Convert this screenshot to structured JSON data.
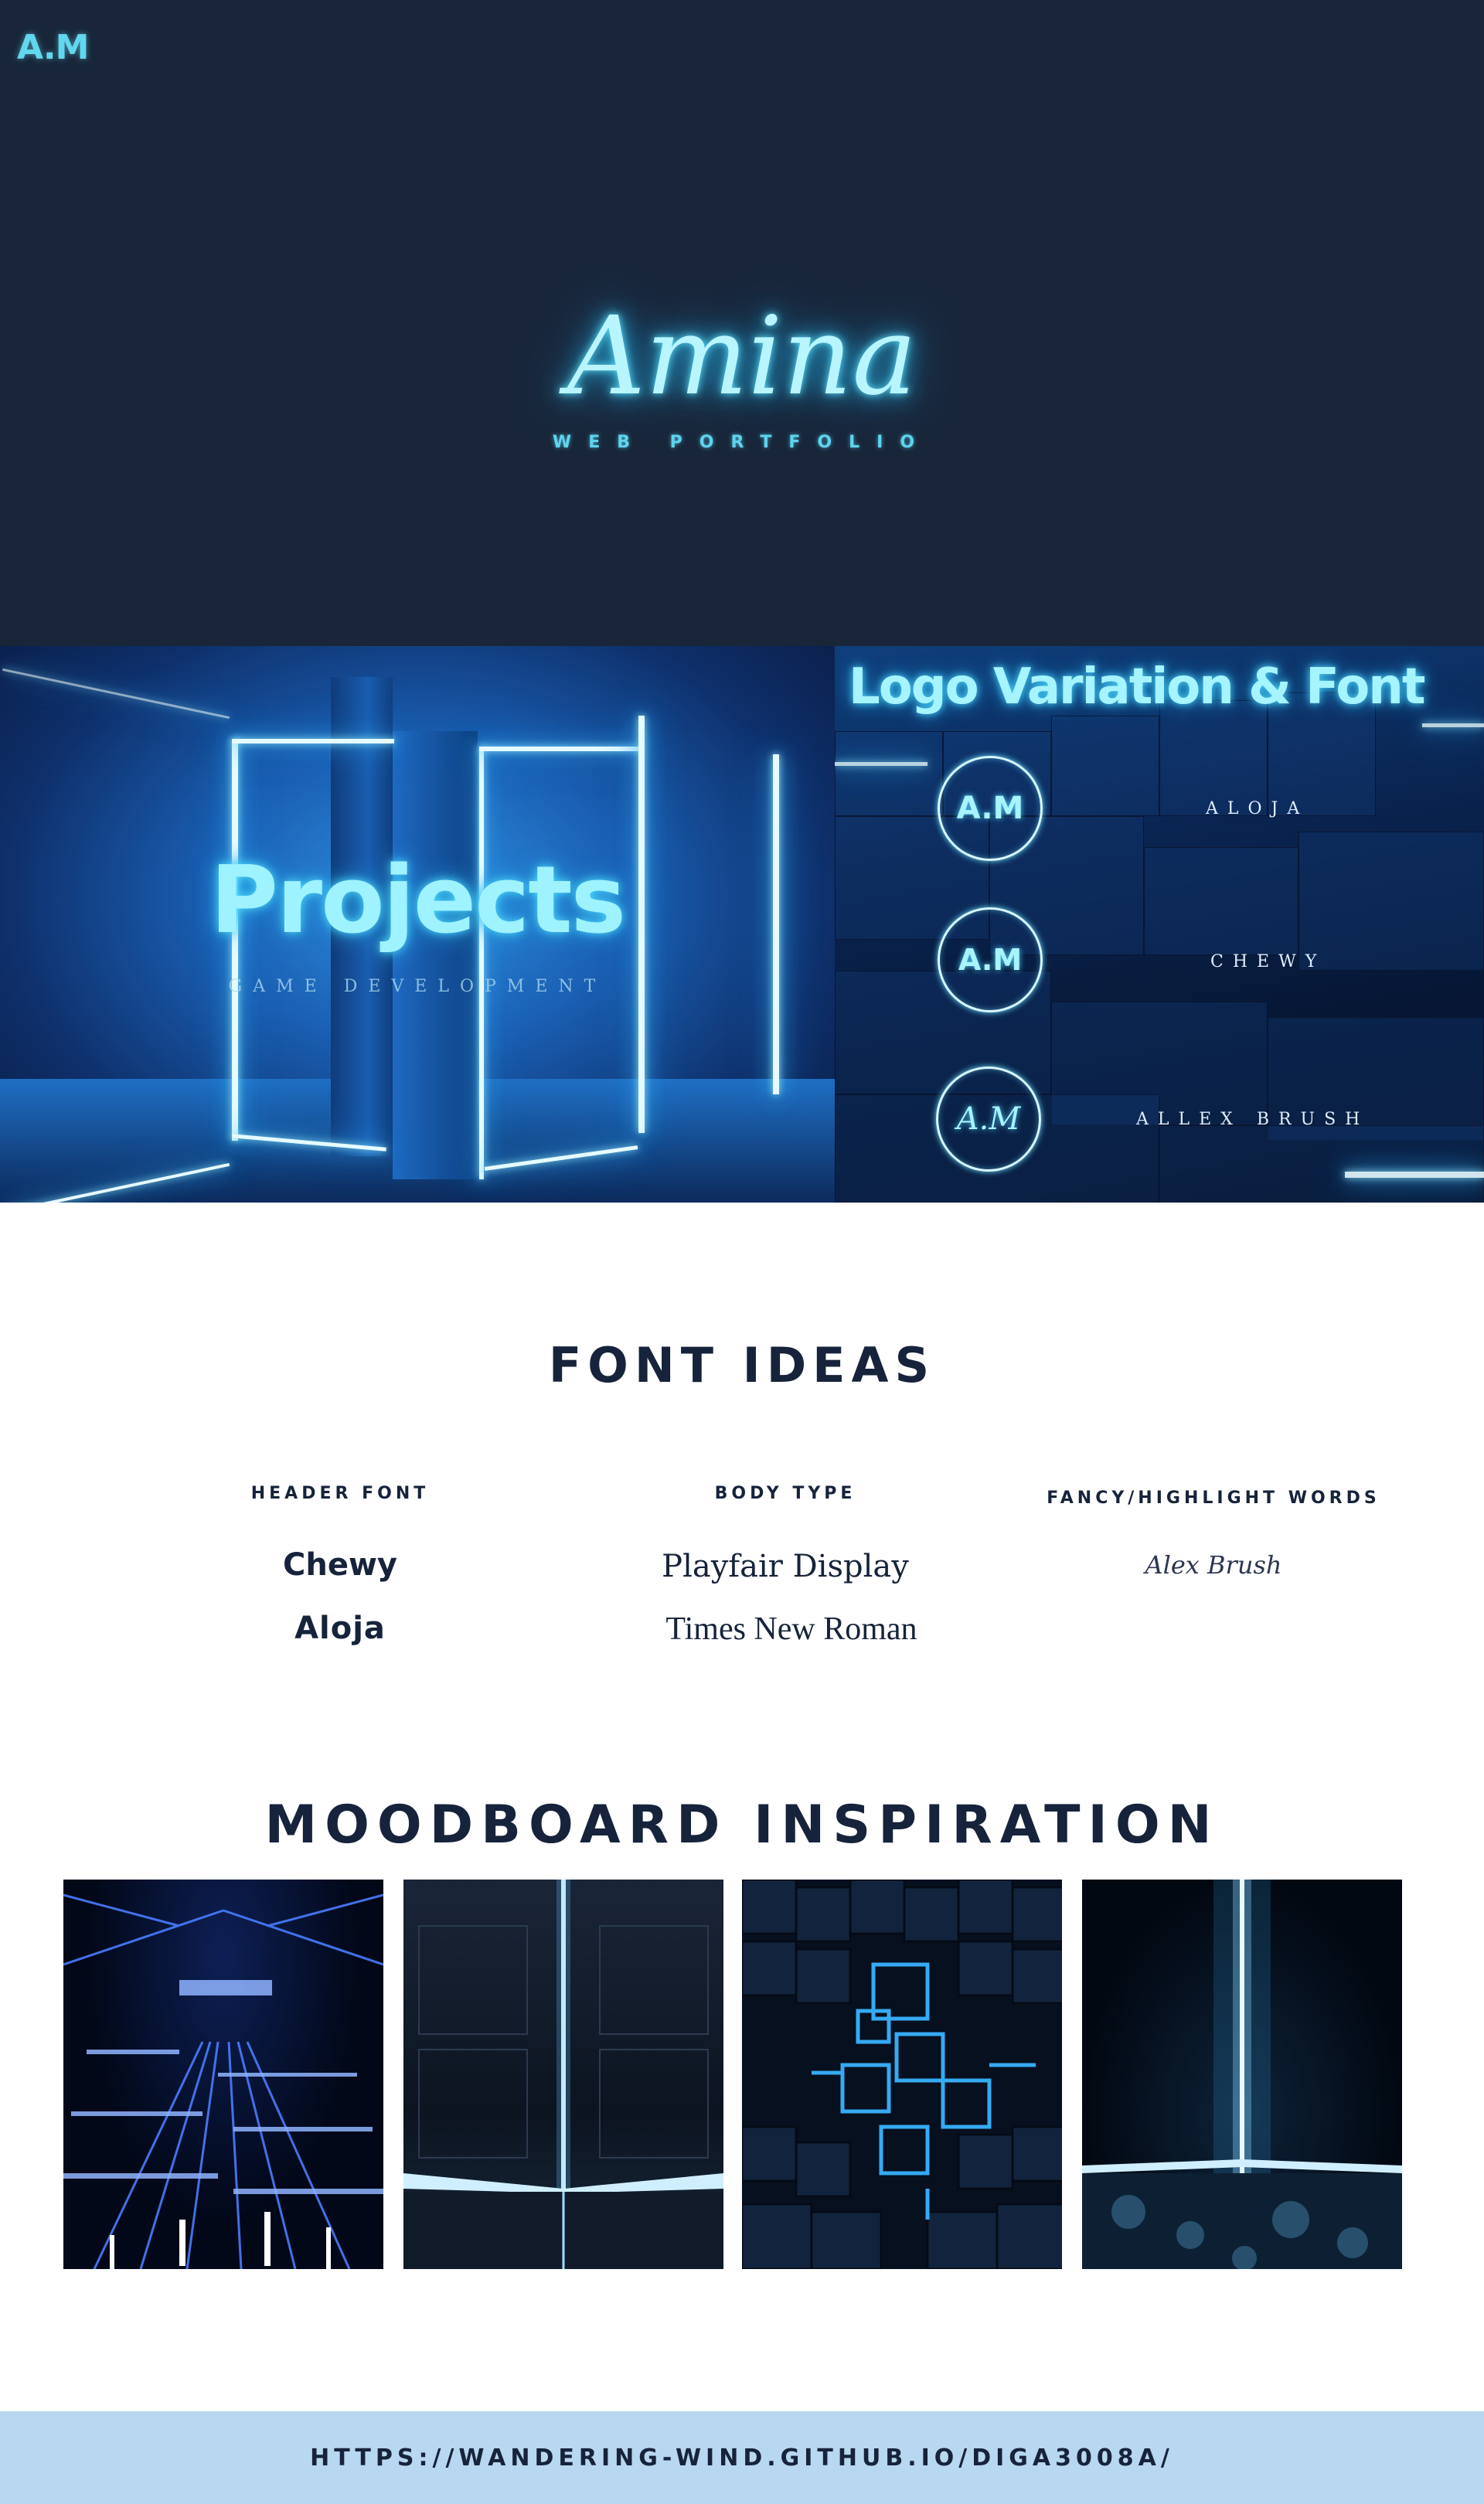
{
  "hero": {
    "logo": "A.M",
    "title": "Amina",
    "subtitle": "WEB PORTFOLIO"
  },
  "projects": {
    "title": "Projects",
    "subtitle": "GAME DEVELOPMENT"
  },
  "logo_variations": {
    "title": "Logo Variation & Font",
    "items": [
      {
        "mark": "A.M",
        "font": "ALOJA"
      },
      {
        "mark": "A.M",
        "font": "CHEWY"
      },
      {
        "mark": "A.M",
        "font": "ALLEX BRUSH"
      }
    ]
  },
  "font_ideas": {
    "title": "FONT IDEAS",
    "columns": [
      {
        "heading": "HEADER FONT",
        "samples": [
          "Chewy",
          "Aloja"
        ]
      },
      {
        "heading": "BODY TYPE",
        "samples": [
          "Playfair Display",
          "Times New Roman"
        ]
      },
      {
        "heading": "FANCY/HIGHLIGHT WORDS",
        "samples": [
          "Alex Brush"
        ]
      }
    ]
  },
  "moodboard": {
    "title": "MOODBOARD INSPIRATION",
    "images": [
      "neon-grid-city-image",
      "corner-light-room-image",
      "glowing-cubes-image",
      "light-beam-smoke-image"
    ]
  },
  "footer": {
    "url": "HTTPS://WANDERING-WIND.GITHUB.IO/DIGA3008A/"
  },
  "colors": {
    "navy": "#19263a",
    "neon_cyan": "#62d7ee",
    "footer_bg": "#b8d7f0",
    "text_dark": "#16233a"
  }
}
